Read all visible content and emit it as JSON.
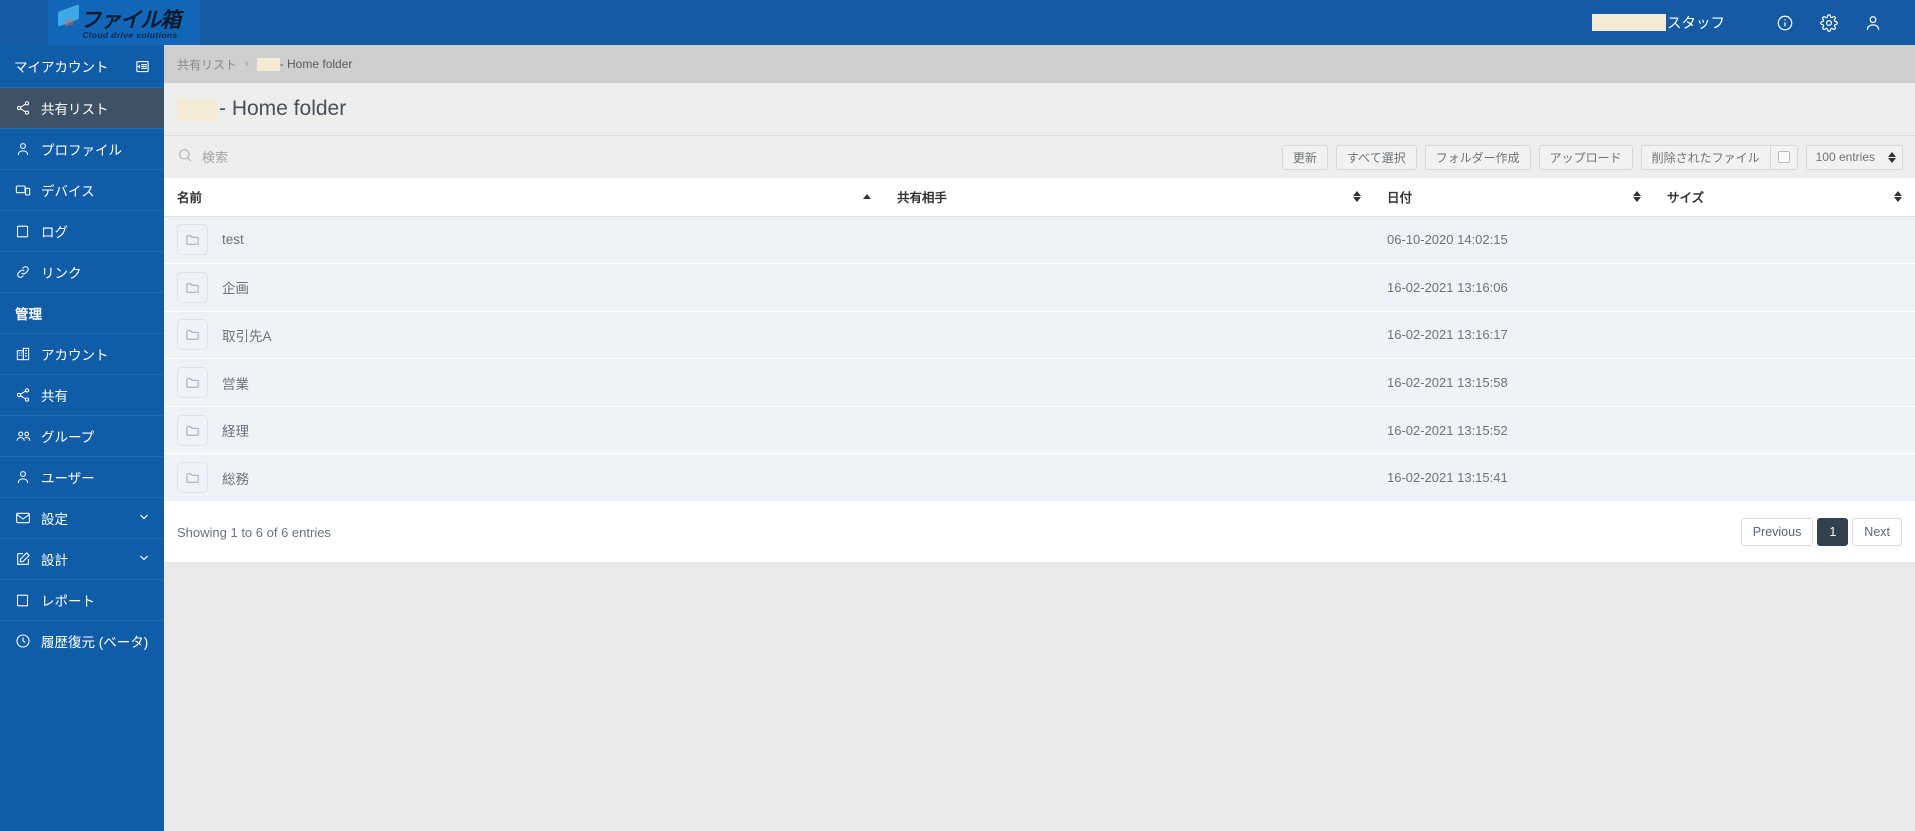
{
  "header": {
    "logo_text": "ファイル箱",
    "logo_tagline": "Cloud drive solutions",
    "user_name_redacted": "",
    "user_role": "スタッフ",
    "icons": [
      "info-icon",
      "gear-icon",
      "user-icon"
    ],
    "brand_color": "#145ba4"
  },
  "sidebar": {
    "account_label": "マイアカウント",
    "collapse_icon": "collapse-menu-icon",
    "items": [
      {
        "label": "共有リスト",
        "icon": "share-nodes-icon",
        "active": true
      },
      {
        "label": "プロファイル",
        "icon": "user-icon",
        "active": false
      },
      {
        "label": "デバイス",
        "icon": "device-icon",
        "active": false
      },
      {
        "label": "ログ",
        "icon": "square-icon",
        "active": false
      },
      {
        "label": "リンク",
        "icon": "link-icon",
        "active": false
      }
    ],
    "admin_section_label": "管理",
    "admin_items": [
      {
        "label": "アカウント",
        "icon": "building-icon",
        "chevron": false
      },
      {
        "label": "共有",
        "icon": "share-nodes-icon",
        "chevron": false
      },
      {
        "label": "グループ",
        "icon": "users-icon",
        "chevron": false
      },
      {
        "label": "ユーザー",
        "icon": "user-icon",
        "chevron": false
      },
      {
        "label": "設定",
        "icon": "envelope-icon",
        "chevron": true
      },
      {
        "label": "設計",
        "icon": "edit-pencil-icon",
        "chevron": true
      },
      {
        "label": "レポート",
        "icon": "square-icon",
        "chevron": false
      },
      {
        "label": "履歴復元 (ベータ)",
        "icon": "clock-icon",
        "chevron": false
      }
    ],
    "active_bg": "#3f5265",
    "bg": "#115ca6"
  },
  "breadcrumb": {
    "root": "共有リスト",
    "separator": "›",
    "current": "- Home folder"
  },
  "page": {
    "title_suffix": "- Home folder"
  },
  "search": {
    "placeholder": "検索",
    "value": "",
    "icon": "search-icon"
  },
  "toolbar": {
    "refresh_label": "更新",
    "select_all_label": "すべて選択",
    "create_folder_label": "フォルダー作成",
    "upload_label": "アップロード",
    "deleted_files_label": "削除されたファイル",
    "deleted_files_checked": false,
    "entries_select_value": "100 entries"
  },
  "table": {
    "columns": [
      {
        "label": "名前",
        "sort": "asc"
      },
      {
        "label": "共有相手",
        "sort": "none"
      },
      {
        "label": "日付",
        "sort": "none"
      },
      {
        "label": "サイズ",
        "sort": "none"
      }
    ],
    "rows": [
      {
        "icon": "folder-icon",
        "name": "test",
        "shared_with": "",
        "date": "06-10-2020 14:02:15",
        "size": ""
      },
      {
        "icon": "folder-icon",
        "name": "企画",
        "shared_with": "",
        "date": "16-02-2021 13:16:06",
        "size": ""
      },
      {
        "icon": "folder-icon",
        "name": "取引先A",
        "shared_with": "",
        "date": "16-02-2021 13:16:17",
        "size": ""
      },
      {
        "icon": "folder-icon",
        "name": "営業",
        "shared_with": "",
        "date": "16-02-2021 13:15:58",
        "size": ""
      },
      {
        "icon": "folder-icon",
        "name": "経理",
        "shared_with": "",
        "date": "16-02-2021 13:15:52",
        "size": ""
      },
      {
        "icon": "folder-icon",
        "name": "総務",
        "shared_with": "",
        "date": "16-02-2021 13:15:41",
        "size": ""
      }
    ]
  },
  "footer": {
    "showing": "Showing 1 to 6 of 6 entries",
    "previous_label": "Previous",
    "page_number": "1",
    "next_label": "Next"
  }
}
